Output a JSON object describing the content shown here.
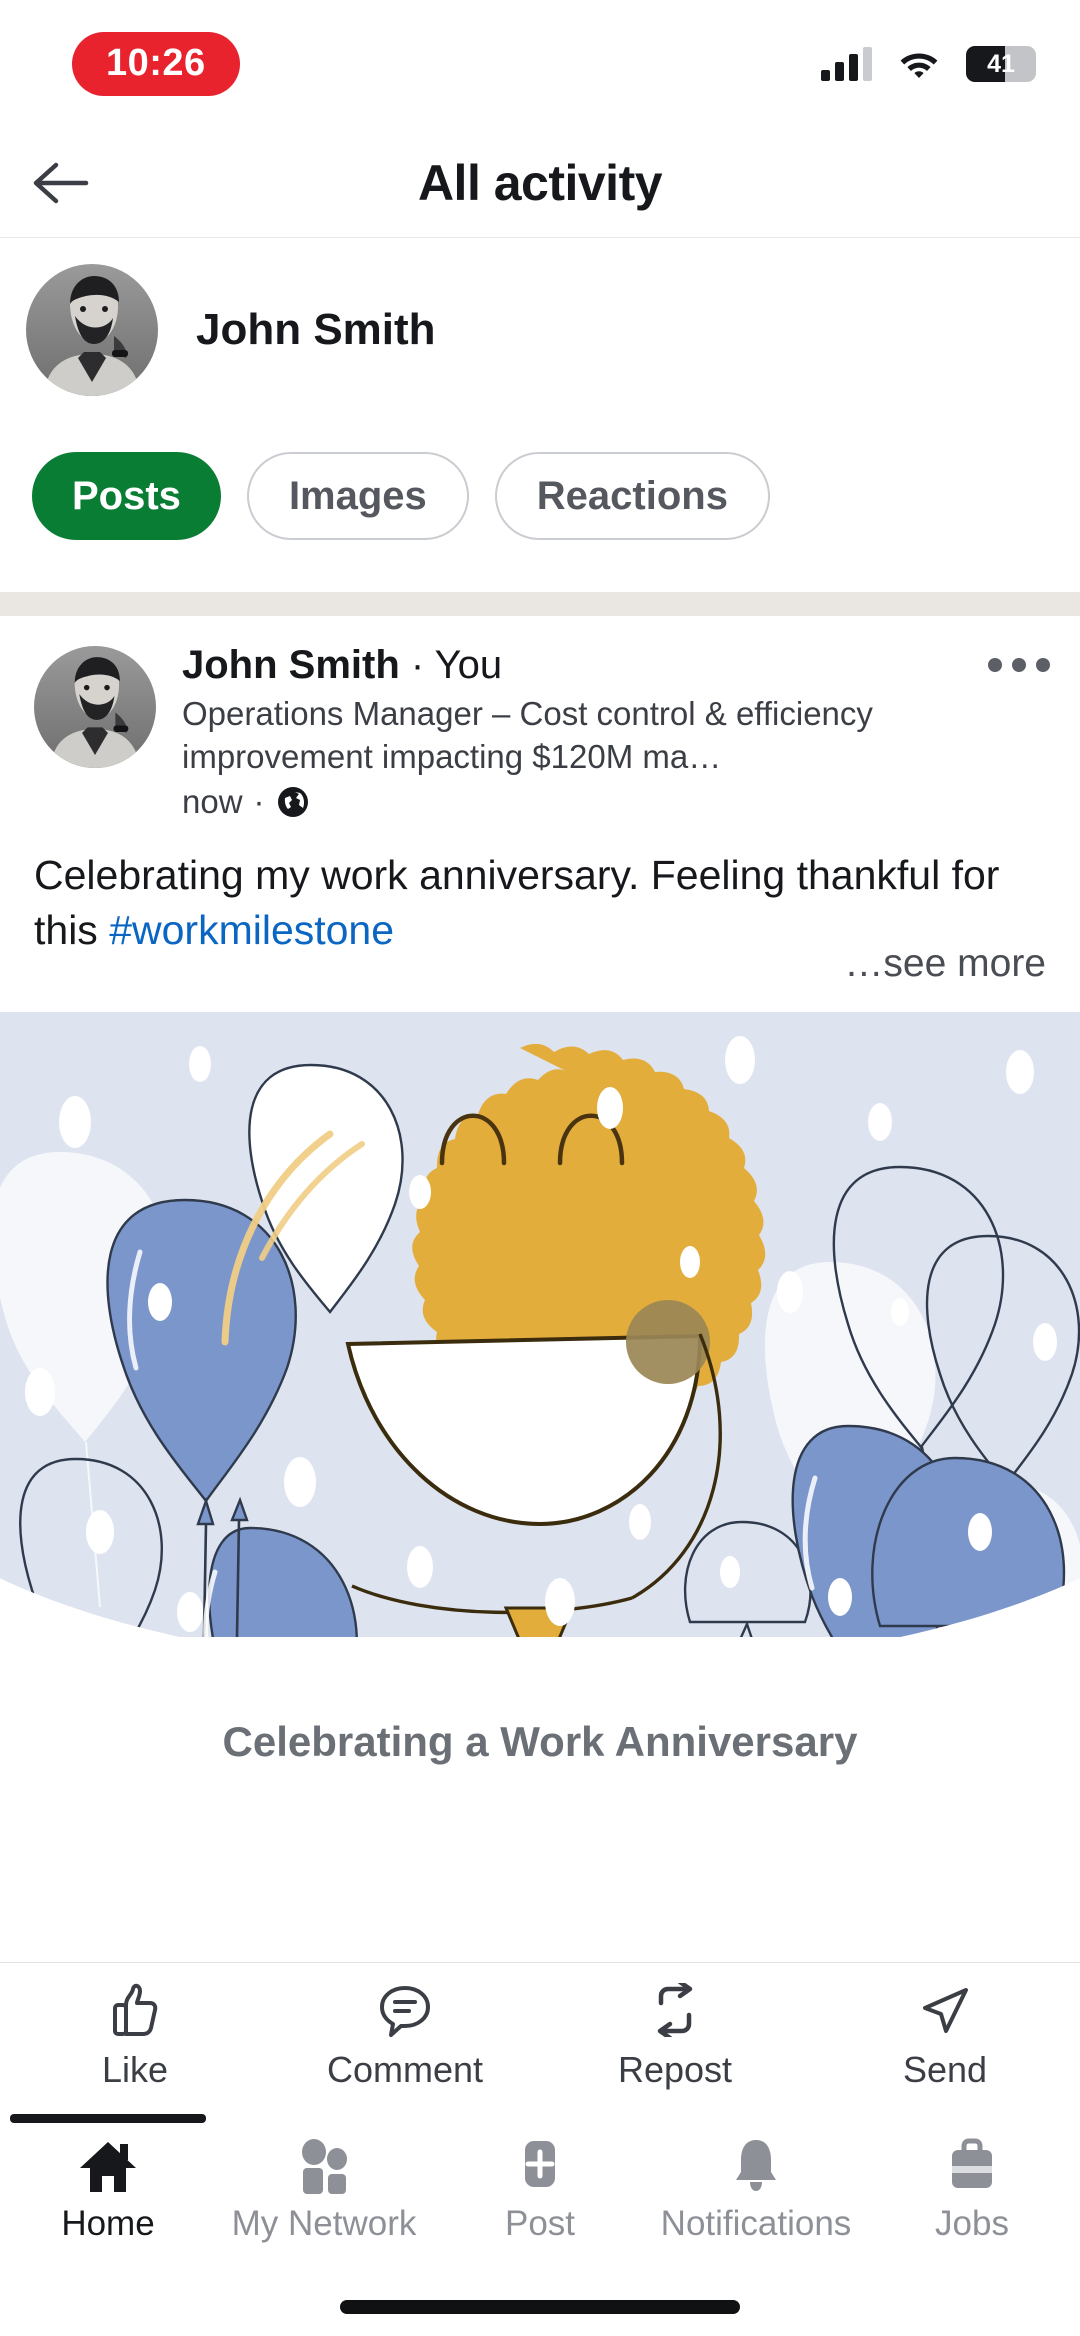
{
  "status_bar": {
    "time": "10:26",
    "battery_level": "41",
    "icons": [
      "signal-icon",
      "wifi-icon",
      "battery-icon"
    ]
  },
  "header": {
    "title": "All activity",
    "back_icon": "back-arrow-icon"
  },
  "profile": {
    "name": "John Smith",
    "avatar": "profile-avatar"
  },
  "filters": [
    {
      "label": "Posts",
      "selected": true
    },
    {
      "label": "Images",
      "selected": false
    },
    {
      "label": "Reactions",
      "selected": false
    }
  ],
  "post": {
    "author": "John Smith",
    "separator": "·",
    "relation": "You",
    "headline": "Operations Manager – Cost control & efficiency improvement impacting $120M ma…",
    "timestamp": "now",
    "visibility_icon": "globe-icon",
    "more_icon": "more-options-icon",
    "text_before_tag": "Celebrating my work anniversary. Feeling thankful for this ",
    "hashtag": "#workmilestone",
    "see_more": "…see more",
    "image_caption": "Celebrating a Work Anniversary",
    "image_alt": "work-anniversary-balloons-illustration"
  },
  "actions": [
    {
      "label": "Like",
      "icon": "thumbs-up-icon"
    },
    {
      "label": "Comment",
      "icon": "comment-bubble-icon"
    },
    {
      "label": "Repost",
      "icon": "repost-icon"
    },
    {
      "label": "Send",
      "icon": "send-paper-plane-icon"
    }
  ],
  "bottom_nav": [
    {
      "label": "Home",
      "icon": "home-icon",
      "active": true
    },
    {
      "label": "My Network",
      "icon": "people-icon",
      "active": false
    },
    {
      "label": "Post",
      "icon": "plus-square-icon",
      "active": false
    },
    {
      "label": "Notifications",
      "icon": "bell-icon",
      "active": false
    },
    {
      "label": "Jobs",
      "icon": "briefcase-icon",
      "active": false
    }
  ],
  "colors": {
    "accent_green": "#0a7d35",
    "link_blue": "#0a66c2",
    "time_pill_red": "#e8232e",
    "illustration_bg": "#dde3ef",
    "balloon_blue": "#7b96cb",
    "balloon_gold": "#e3ad3c"
  }
}
